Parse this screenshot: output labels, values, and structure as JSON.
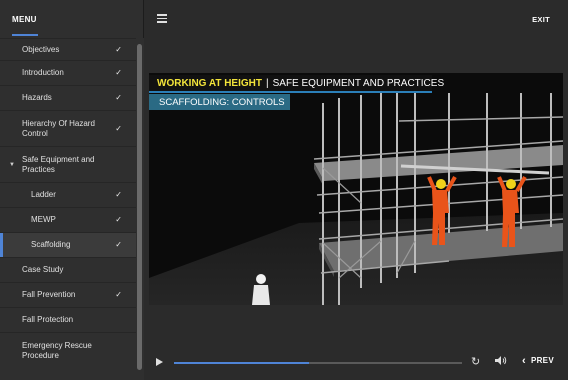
{
  "sidebar": {
    "title": "MENU",
    "items": [
      {
        "label": "Objectives",
        "checked": "✓"
      },
      {
        "label": "Introduction",
        "checked": "✓"
      },
      {
        "label": "Hazards",
        "checked": "✓"
      },
      {
        "label": "Hierarchy Of Hazard Control",
        "checked": "✓"
      },
      {
        "label": "Safe Equipment and Practices",
        "expanded": "▼"
      },
      {
        "label": "Ladder",
        "checked": "✓"
      },
      {
        "label": "MEWP",
        "checked": "✓"
      },
      {
        "label": "Scaffolding",
        "checked": "✓"
      },
      {
        "label": "Case Study"
      },
      {
        "label": "Fall Prevention",
        "checked": "✓"
      },
      {
        "label": "Fall Protection"
      },
      {
        "label": "Emergency Rescue Procedure"
      }
    ]
  },
  "header": {
    "menu_icon": "hamburger-icon",
    "exit_label": "EXIT"
  },
  "video": {
    "title_main": "WORKING AT HEIGHT",
    "title_sep": "|",
    "title_section": "SAFE EQUIPMENT AND PRACTICES",
    "subtitle": "SCAFFOLDING: CONTROLS"
  },
  "controls": {
    "play_icon": "play-icon",
    "replay_icon": "replay-icon",
    "volume_icon": "volume-icon",
    "prev_label": "PREV",
    "progress_fraction": 0.47
  },
  "colors": {
    "accent": "#4f84d6",
    "title_yellow": "#f2e43a",
    "subtitle_bg": "#2a6a84",
    "worker_orange": "#e9541a"
  }
}
